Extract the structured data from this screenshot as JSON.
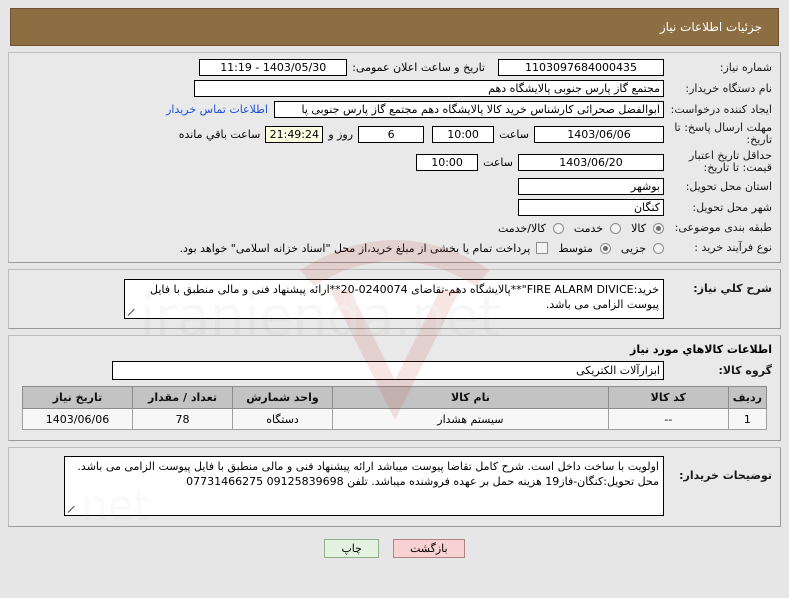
{
  "header": {
    "title": "جزئیات اطلاعات نیاز"
  },
  "form": {
    "need_number_label": "شماره نیاز:",
    "need_number_value": "1103097684000435",
    "public_announce_label": "تاریخ و ساعت اعلان عمومی:",
    "public_announce_value": "1403/05/30 - 11:19",
    "buyer_org_label": "نام دستگاه خریدار:",
    "buyer_org_value": "مجتمع گاز پارس جنوبی  پالایشگاه دهم",
    "creator_label": "ایجاد کننده درخواست:",
    "creator_value": "ابوالفضل صحرائی کارشناس خرید کالا پالایشگاه دهم مجتمع گاز پارس جنوبی  پا",
    "contact_link": "اطلاعات تماس خریدار",
    "deadline_label": "مهلت ارسال پاسخ: تا تاریخ:",
    "deadline_date": "1403/06/06",
    "hour_label": "ساعت",
    "deadline_time": "10:00",
    "days_remaining": "6",
    "days_word": "روز و",
    "time_remaining": "21:49:24",
    "remaining_suffix": "ساعت باقي مانده",
    "price_validity_label": "حداقل تاریخ اعتبار قیمت: تا تاریخ:",
    "price_validity_date": "1403/06/20",
    "price_validity_time": "10:00",
    "province_label": "استان محل تحویل:",
    "province_value": "بوشهر",
    "city_label": "شهر محل تحویل:",
    "city_value": "کنگان",
    "category_label": "طبقه بندی موضوعی:",
    "category_options": [
      {
        "label": "کالا",
        "selected": true
      },
      {
        "label": "خدمت",
        "selected": false
      },
      {
        "label": "کالا/خدمت",
        "selected": false
      }
    ],
    "process_label": "نوع فرآیند خرید :",
    "process_options": [
      {
        "label": "جزیی",
        "selected": false
      },
      {
        "label": "متوسط",
        "selected": true
      }
    ],
    "treasury_checkbox_text": "پرداخت تمام یا بخشی از مبلغ خرید،از محل \"اسناد خزانه اسلامی\" خواهد بود.",
    "treasury_checked": false
  },
  "description": {
    "label": "شرح كلي نياز:",
    "text": "خرید:FIRE ALARM DIVICE\"**پالایشگاه دهم-تقاضای 0240074-20**ارائه پیشنهاد فنی و مالی منطبق با فایل پیوست الزامی می باشد."
  },
  "goods_section": {
    "title": "اطلاعات كالاهاي مورد نياز",
    "group_label": "گروه كالا:",
    "group_value": "ابزارآلات الکتریکی",
    "table": {
      "headers": [
        "ردیف",
        "کد کالا",
        "نام کالا",
        "واحد شمارش",
        "تعداد / مقدار",
        "تاریخ نیاز"
      ],
      "rows": [
        [
          "1",
          "--",
          "سیستم هشدار",
          "دستگاه",
          "78",
          "1403/06/06"
        ]
      ]
    }
  },
  "buyer_notes": {
    "label": "توضيحات خريدار:",
    "text": "اولویت با ساخت داخل است. شرح کامل تقاضا پیوست میباشد ارائه پیشنهاد فنی و مالی منطبق با فایل پیوست الزامی می باشد. محل تحویل:کنگان-فاز19 هزینه حمل بر عهده فروشنده میباشد. تلفن 09125839698  07731466275"
  },
  "footer": {
    "back_label": "بازگشت",
    "print_label": "چاپ"
  }
}
